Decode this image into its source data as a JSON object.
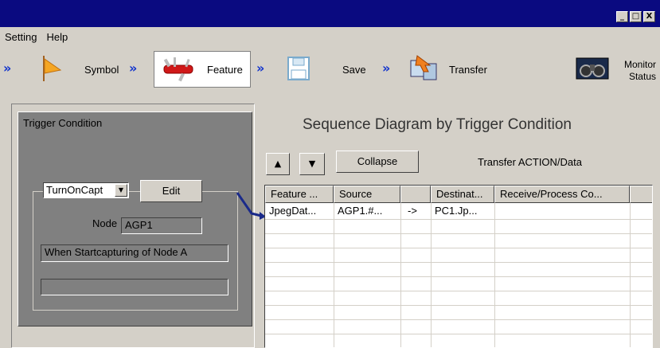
{
  "window": {
    "buttons": [
      "_",
      "□",
      "X"
    ]
  },
  "menu": [
    "Setting",
    "Help"
  ],
  "toolbar": {
    "symbol": "Symbol",
    "feature": "Feature",
    "save": "Save",
    "transfer": "Transfer",
    "monitor": "Monitor",
    "status": "Status",
    "chevron": "»"
  },
  "trigger": {
    "title": "Trigger Condition",
    "combo_value": "TurnOnCapt",
    "edit_label": "Edit",
    "node_label": "Node",
    "node_value": "AGP1",
    "description": "When Startcapturing of Node A",
    "extra_value": ""
  },
  "diagram": {
    "title": "Sequence Diagram by Trigger Condition",
    "collapse_label": "Collapse",
    "transfer_label": "Transfer ACTION/Data",
    "up_arrow": "▲",
    "down_arrow": "▼"
  },
  "table": {
    "headers": [
      "Feature ...",
      "Source",
      "",
      "Destinat...",
      "Receive/Process Co..."
    ],
    "rows": [
      [
        "JpegDat...",
        "AGP1.#...",
        "->",
        "PC1.Jp...",
        ""
      ]
    ]
  },
  "colors": {
    "titlebar": "#0a0a80",
    "accent": "#1133cc",
    "panel": "#808080"
  }
}
